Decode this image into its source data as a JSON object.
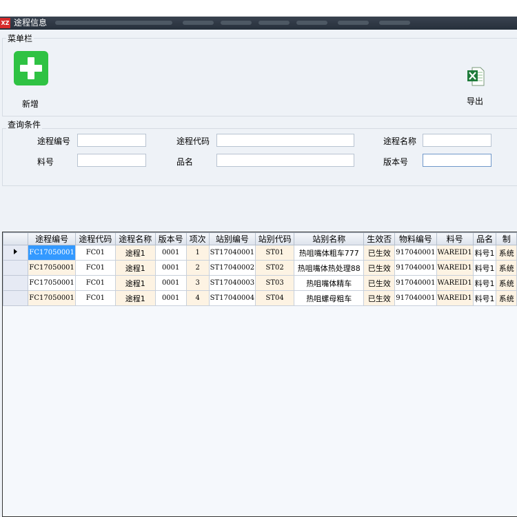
{
  "window": {
    "logo": "XZ",
    "title": "途程信息"
  },
  "menu_group": {
    "label": "菜单栏",
    "add_label": "新增",
    "export_label": "导出"
  },
  "query_group": {
    "label": "查询条件",
    "fields": [
      {
        "label": "途程编号",
        "value": ""
      },
      {
        "label": "途程代码",
        "value": ""
      },
      {
        "label": "途程名称",
        "value": ""
      },
      {
        "label": "料号",
        "value": ""
      },
      {
        "label": "品名",
        "value": ""
      },
      {
        "label": "版本号",
        "value": ""
      }
    ]
  },
  "grid": {
    "columns": [
      "途程编号",
      "途程代码",
      "途程名称",
      "版本号",
      "项次",
      "站别编号",
      "站别代码",
      "站别名称",
      "生效否",
      "物料编号",
      "料号",
      "品名",
      "制"
    ],
    "rows": [
      {
        "current": true,
        "cells": [
          "FC17050001",
          "FC01",
          "途程1",
          "0001",
          "1",
          "ST17040001",
          "ST01",
          "热咀嘴体粗车777",
          "已生效",
          "917040001",
          "WAREID1",
          "料号1",
          "系统"
        ]
      },
      {
        "current": false,
        "cells": [
          "FC17050001",
          "FC01",
          "途程1",
          "0001",
          "2",
          "ST17040002",
          "ST02",
          "热咀嘴体热处理88",
          "已生效",
          "917040001",
          "WAREID1",
          "料号1",
          "系统"
        ]
      },
      {
        "current": false,
        "cells": [
          "FC17050001",
          "FC01",
          "途程1",
          "0001",
          "3",
          "ST17040003",
          "ST03",
          "热咀嘴体精车",
          "已生效",
          "917040001",
          "WAREID1",
          "料号1",
          "系统"
        ]
      },
      {
        "current": false,
        "cells": [
          "FC17050001",
          "FC01",
          "途程1",
          "0001",
          "4",
          "ST17040004",
          "ST04",
          "热咀螺母粗车",
          "已生效",
          "917040001",
          "WAREID1",
          "料号1",
          "系统"
        ]
      }
    ]
  }
}
